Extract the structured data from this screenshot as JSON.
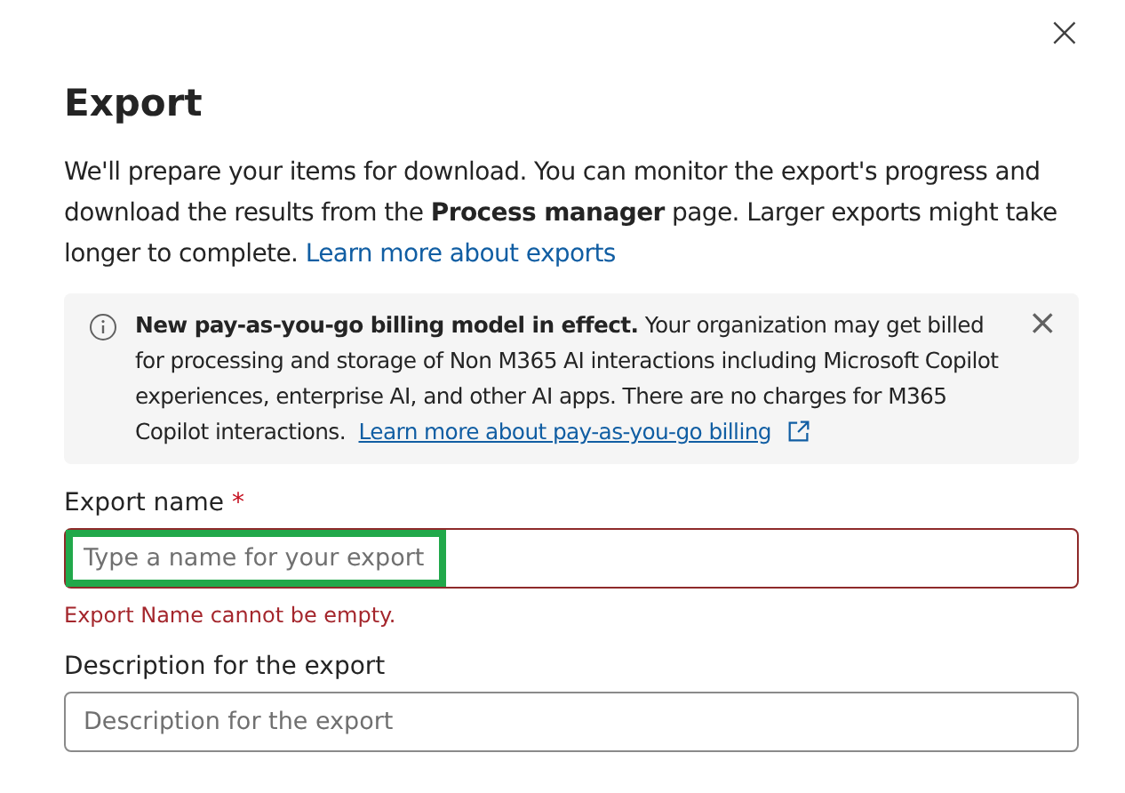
{
  "dialog": {
    "title": "Export",
    "close_label": "×"
  },
  "intro": {
    "text": "We'll prepare your items for download. You can monitor the export's progress and download the results from the **Process manager** page. Larger exports might take longer to complete.",
    "link": "Learn more about exports"
  },
  "banner": {
    "heading": "New pay-as-you-go billing model in effect.",
    "text": "Your organization may get billed for processing and storage of Non M365 AI interactions including Microsoft Copilot experiences, enterprise AI, and other AI apps. There are no charges for M365 Copilot interactions.",
    "link": "Learn more about pay-as-you-go billing",
    "dismiss": "×"
  },
  "fields": [
    {
      "label": "Export name",
      "required": true,
      "required_mark": "*",
      "placeholder": "Type a name for your export",
      "invalid": true,
      "highlighted": true,
      "error": "Export Name cannot be empty."
    },
    {
      "label": "Description for the export",
      "required": false,
      "placeholder": "Description for the export",
      "invalid": false,
      "highlighted": false
    }
  ]
}
